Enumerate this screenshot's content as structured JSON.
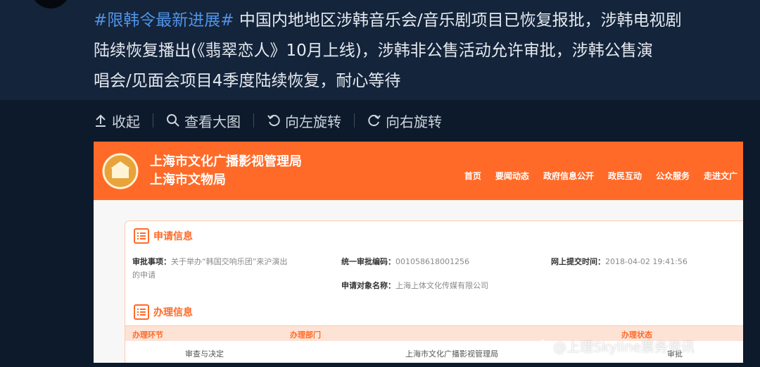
{
  "post": {
    "hashtag": "#限韩令最新进展#",
    "line1": " 中国内地地区涉韩音乐会/音乐剧项目已恢复报批，涉韩电视剧",
    "line2": "陆续恢复播出(《翡翠恋人》10月上线)，涉韩非公售活动允许审批，涉韩公售演",
    "line3": "唱会/见面会项目4季度陆续恢复，耐心等待"
  },
  "toolbar": {
    "collapse": "收起",
    "view_large": "查看大图",
    "rotate_left": "向左旋转",
    "rotate_right": "向右旋转"
  },
  "screenshot": {
    "site_title_1": "上海市文化广播影视管理局",
    "site_title_2": "上海市文物局",
    "nav": [
      "首页",
      "要闻动态",
      "政府信息公开",
      "政民互动",
      "公众服务",
      "走进文广"
    ],
    "section1_title": "申请信息",
    "section2_title": "办理信息",
    "approval_item_label": "审批事项：",
    "approval_item_value_1": "关于举办“韩国交响乐团”来沪演出",
    "approval_item_value_2": "的申请",
    "code_label": "统一审批编码：",
    "code_value": "001058618001256",
    "submit_label": "网上提交时间：",
    "submit_value": "2018-04-02 19:41:56",
    "applicant_label": "申请对象名称：",
    "applicant_value": "上海上体文化传媒有限公司",
    "table_headers": [
      "办理环节",
      "办理部门",
      "办理状态"
    ],
    "row_step": "审查与决定",
    "row_dept": "上海市文化广播影视管理局",
    "row_status": "审批"
  },
  "watermark": "@上理Skyline票务资讯",
  "colors": {
    "accent_orange": "#ff6a28",
    "hashtag_blue": "#4f93e8",
    "background": "#0d1a2b"
  }
}
